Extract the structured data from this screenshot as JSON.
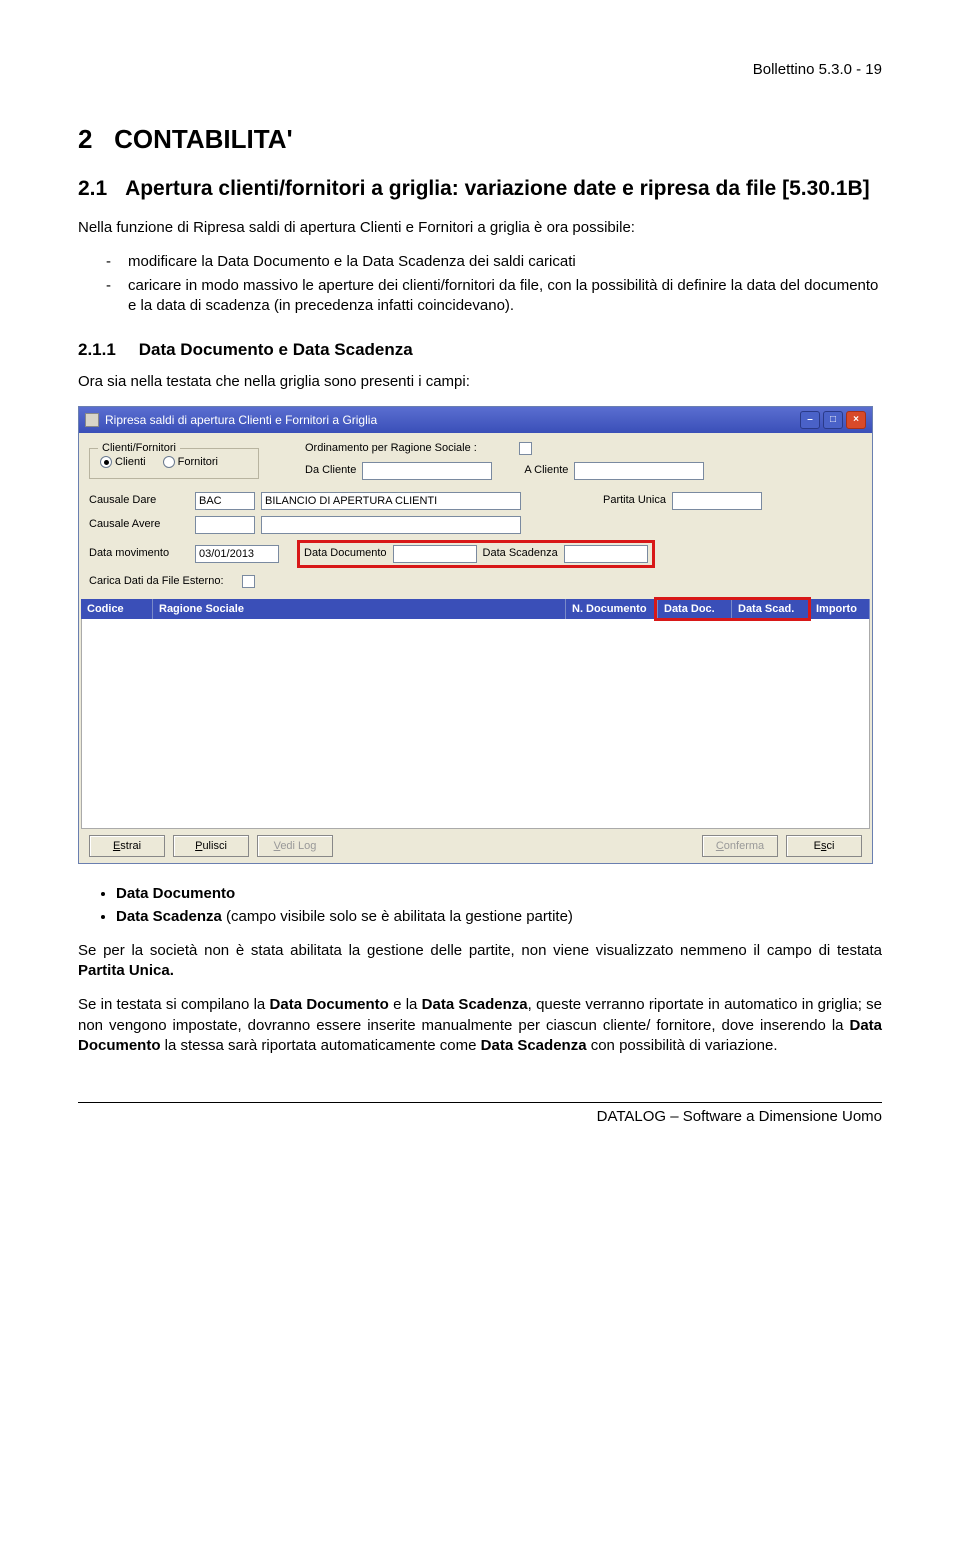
{
  "header": {
    "right": "Bollettino 5.3.0 - 19"
  },
  "section": {
    "num": "2",
    "title": "CONTABILITA'",
    "sub_num": "2.1",
    "sub_title": "Apertura clienti/fornitori a griglia: variazione date e ripresa da file [5.30.1B]",
    "intro": "Nella funzione di Ripresa saldi di apertura Clienti e Fornitori a griglia è ora possibile:",
    "bullets_a": [
      "modificare la Data Documento e la Data Scadenza dei saldi caricati",
      "caricare in modo massivo le aperture dei clienti/fornitori da file, con la possibilità di definire la data del documento e la data di scadenza (in precedenza infatti coincidevano)."
    ],
    "h3_num": "2.1.1",
    "h3_title": "Data Documento e Data Scadenza",
    "h3_intro": "Ora sia nella testata che nella griglia sono presenti i campi:",
    "bullets_b": [
      {
        "label": "Data Documento"
      },
      {
        "label": "Data Scadenza",
        "note": " (campo visibile solo se è abilitata la gestione partite)"
      }
    ],
    "p1_a": "Se per la società non è stata abilitata la gestione delle partite, non viene visualizzato nemmeno il campo di testata ",
    "p1_b": "Partita Unica.",
    "p2": "Se in testata si compilano la Data Documento e la Data Scadenza, queste verranno riportate in automatico in griglia; se non vengono impostate, dovranno essere inserite manualmente per ciascun cliente/ fornitore, dove inserendo la Data Documento la stessa sarà riportata automaticamente come Data Scadenza con possibilità di variazione."
  },
  "screenshot": {
    "title": "Ripresa saldi di apertura Clienti e Fornitori a Griglia",
    "group_label": "Clienti/Fornitori",
    "radio_clienti": "Clienti",
    "radio_fornitori": "Fornitori",
    "ord_label": "Ordinamento per Ragione Sociale :",
    "da_cliente_lbl": "Da Cliente",
    "a_cliente_lbl": "A Cliente",
    "causale_dare_lbl": "Causale Dare",
    "causale_dare_val": "BAC",
    "causale_dare_desc": "BILANCIO DI APERTURA CLIENTI",
    "partita_unica_lbl": "Partita Unica",
    "causale_avere_lbl": "Causale Avere",
    "data_mov_lbl": "Data movimento",
    "data_mov_val": "03/01/2013",
    "data_doc_lbl": "Data Documento",
    "data_scad_lbl": "Data Scadenza",
    "carica_lbl": "Carica Dati da File Esterno:",
    "grid": {
      "codice": "Codice",
      "ragione": "Ragione Sociale",
      "ndoc": "N. Documento",
      "datadoc": "Data Doc.",
      "datascad": "Data Scad.",
      "importo": "Importo"
    },
    "buttons": {
      "estrai": "Estrai",
      "pulisci": "Pulisci",
      "vedilog": "Vedi Log",
      "conferma": "Conferma",
      "esci": "Esci"
    }
  },
  "footer": {
    "text": "DATALOG – Software a Dimensione Uomo"
  }
}
